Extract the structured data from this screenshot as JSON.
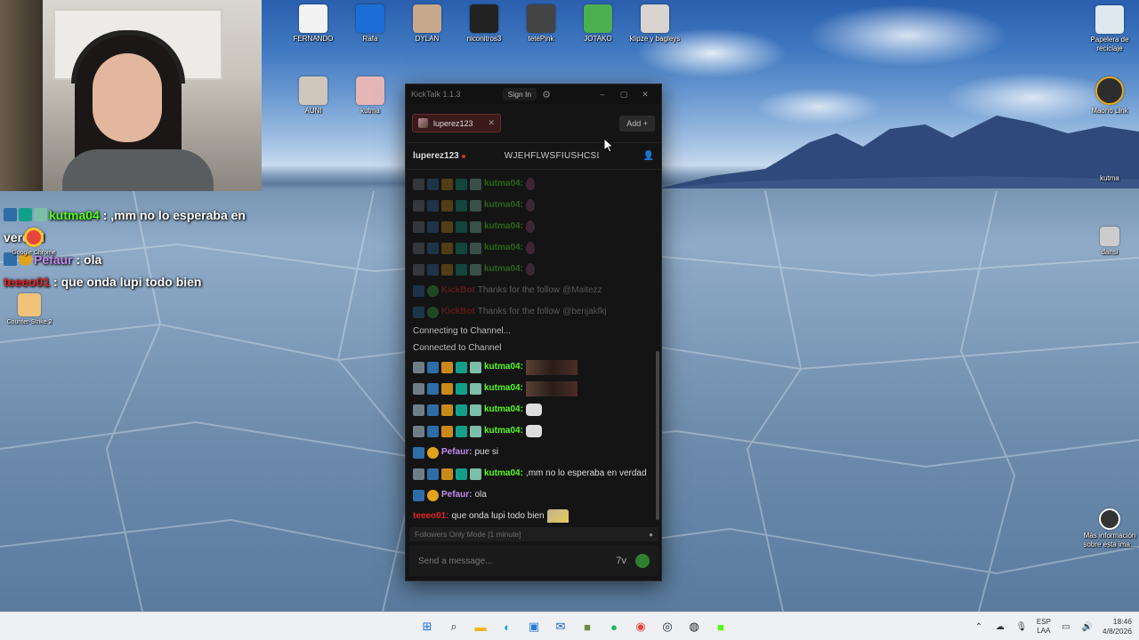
{
  "desktop": {
    "icons": [
      {
        "label": "FERNANDO",
        "color": "#f2f2f2"
      },
      {
        "label": "Rafa",
        "color": "#1b6ed6"
      },
      {
        "label": "DYLAN",
        "color": "#c6a88a"
      },
      {
        "label": "niconitros3",
        "color": "#222222"
      },
      {
        "label": "tetePink",
        "color": "#444444"
      },
      {
        "label": "JOTAKO",
        "color": "#4caf50"
      },
      {
        "label": "klipze y bagleys",
        "color": "#d9d4cf"
      },
      {
        "label": "AUNI",
        "color": "#cfc6bb"
      },
      {
        "label": "kutma",
        "color": "#e6b5b5"
      },
      {
        "label": "Papelera de reciclaje",
        "color": "#dfe8f0"
      },
      {
        "label": "Maono Link",
        "color": "#2d2d2d"
      },
      {
        "label": "kutma",
        "color": "#6a6a6a"
      },
      {
        "label": "dansi",
        "color": "#cccccc"
      },
      {
        "label": "Más información sobre esta ima...",
        "color": "#333333"
      },
      {
        "label": "Google Chrome",
        "color": "#e8453c"
      },
      {
        "label": "Counter-Strike 2",
        "color": "#f0c27a"
      }
    ]
  },
  "overlay_chat": [
    {
      "user": "kutma04",
      "text": ",mm no lo esperaba en verdad"
    },
    {
      "user": "Pefaur",
      "text": "ola"
    },
    {
      "user": "teeeo01",
      "text": "que onda lupi todo bien"
    }
  ],
  "kicktalk": {
    "app_title": "KickTalk 1.1.3",
    "sign_in_label": "Sign In",
    "tab": {
      "label": "luperez123"
    },
    "add_label": "Add",
    "channel": {
      "name": "luperez123",
      "stream_title": "WJEHFLWSFIUSHCSI"
    },
    "messages": [
      {
        "kind": "chat",
        "faded": true,
        "user": "kutma04",
        "color": "green",
        "emote": "drop"
      },
      {
        "kind": "chat",
        "faded": true,
        "user": "kutma04",
        "color": "green",
        "emote": "drop"
      },
      {
        "kind": "chat",
        "faded": true,
        "user": "kutma04",
        "color": "green",
        "emote": "drop"
      },
      {
        "kind": "chat",
        "faded": true,
        "user": "kutma04",
        "color": "green",
        "emote": "drop"
      },
      {
        "kind": "chat",
        "faded": true,
        "user": "kutma04",
        "color": "green",
        "emote": "drop"
      },
      {
        "kind": "bot",
        "faded": true,
        "user": "KickBot",
        "text": "Thanks for the follow",
        "mention": "@Maitezz"
      },
      {
        "kind": "bot",
        "faded": true,
        "user": "KickBot",
        "text": "Thanks for the follow",
        "mention": "@benjakfkj"
      },
      {
        "kind": "system",
        "text": "Connecting to Channel..."
      },
      {
        "kind": "system",
        "text": "Connected to Channel"
      },
      {
        "kind": "chat",
        "user": "kutma04",
        "color": "green",
        "emote": "img"
      },
      {
        "kind": "chat",
        "user": "kutma04",
        "color": "green",
        "emote": "img"
      },
      {
        "kind": "chat",
        "user": "kutma04",
        "color": "green",
        "emote": "cat"
      },
      {
        "kind": "chat",
        "user": "kutma04",
        "color": "green",
        "emote": "cat"
      },
      {
        "kind": "chat",
        "user": "Pefaur",
        "color": "purple",
        "text": "pue si"
      },
      {
        "kind": "chat",
        "user": "kutma04",
        "color": "green",
        "text": ",mm no lo esperaba en verdad"
      },
      {
        "kind": "chat",
        "user": "Pefaur",
        "color": "purple",
        "text": "ola"
      },
      {
        "kind": "chat",
        "user": "teeeo01",
        "color": "red",
        "text": "que onda lupi todo bien",
        "emote": "dog"
      }
    ],
    "mode_notice": "Followers Only Mode [1 minute]",
    "input_placeholder": "Send a message..."
  },
  "taskbar": {
    "apps": [
      {
        "name": "start-button",
        "glyph": "⊞",
        "color": "#1a73e8"
      },
      {
        "name": "search-button",
        "glyph": "⌕",
        "color": "#333333"
      },
      {
        "name": "file-explorer",
        "glyph": "▬",
        "color": "#f3b21a"
      },
      {
        "name": "edge-browser",
        "glyph": "◐",
        "color": "#1aa3c8"
      },
      {
        "name": "store-app",
        "glyph": "▣",
        "color": "#2a7bd6"
      },
      {
        "name": "outlook-app",
        "glyph": "✉",
        "color": "#1a62c4"
      },
      {
        "name": "minecraft-app",
        "glyph": "■",
        "color": "#6b8a3a"
      },
      {
        "name": "spotify-app",
        "glyph": "●",
        "color": "#1db954"
      },
      {
        "name": "chrome-app",
        "glyph": "◉",
        "color": "#e8453c"
      },
      {
        "name": "steam-app",
        "glyph": "◎",
        "color": "#1b2838"
      },
      {
        "name": "obs-app",
        "glyph": "◍",
        "color": "#222222"
      },
      {
        "name": "kick-app",
        "glyph": "■",
        "color": "#53fc18"
      }
    ],
    "language": {
      "line1": "ESP",
      "line2": "LAA"
    },
    "time": "18:46",
    "date": "4/8/2026"
  }
}
